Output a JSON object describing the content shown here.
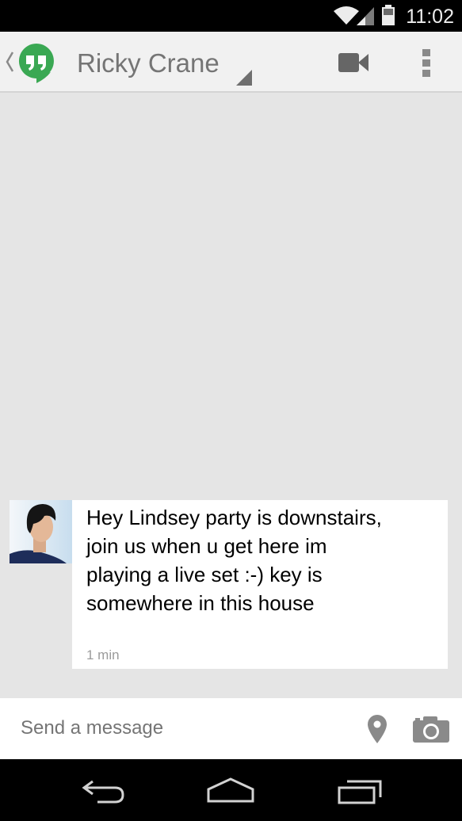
{
  "status_bar": {
    "time": "11:02",
    "icons": [
      "wifi-icon",
      "cell-signal-icon",
      "battery-icon"
    ]
  },
  "action_bar": {
    "app_icon": "hangouts-logo-icon",
    "contact_name": "Ricky Crane",
    "actions": [
      "video-call-icon",
      "overflow-menu-icon"
    ]
  },
  "conversation": {
    "messages": [
      {
        "text": "Hey Lindsey party is downstairs, join us when u get here im playing a live set :-) key is somewhere in this house",
        "time": "1 min"
      }
    ]
  },
  "compose": {
    "placeholder": "Send a message",
    "icons": [
      "location-icon",
      "camera-icon"
    ]
  },
  "nav_bar": {
    "icons": [
      "back-icon",
      "home-icon",
      "recents-icon"
    ]
  },
  "colors": {
    "hangouts_green": "#3aa853",
    "background": "#e5e5e5",
    "bubble": "#ffffff"
  }
}
